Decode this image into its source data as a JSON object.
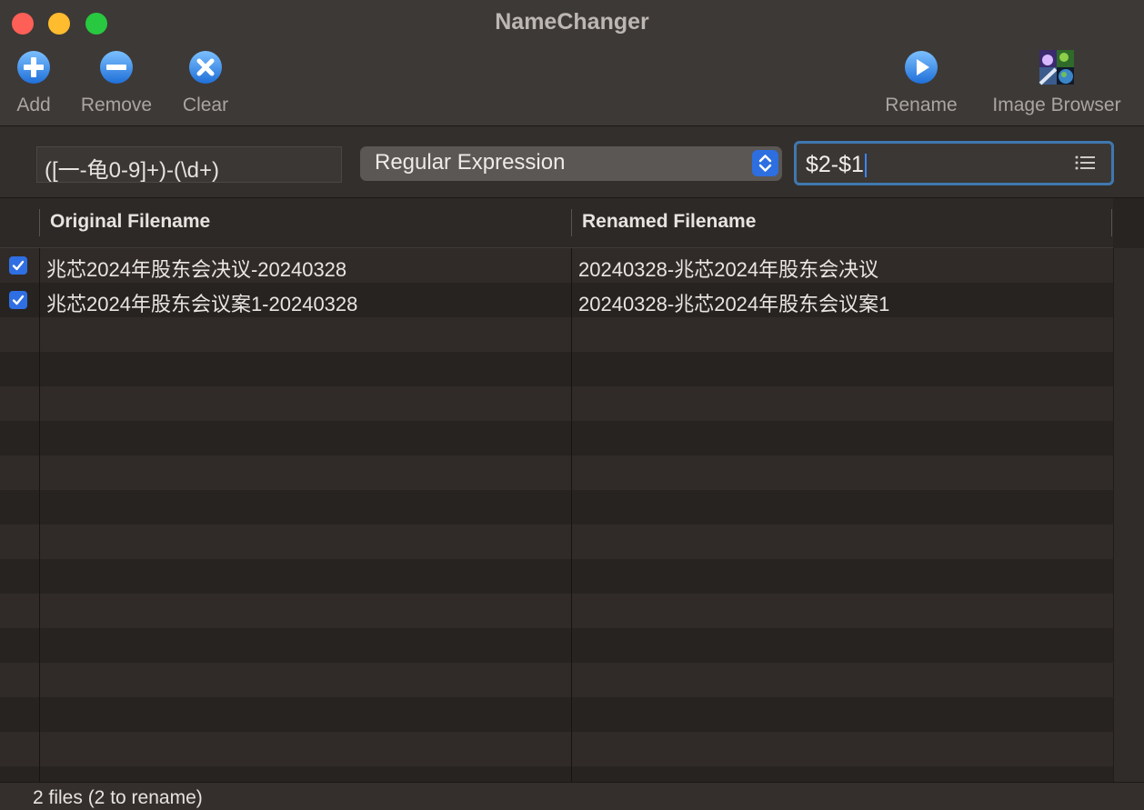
{
  "window": {
    "title": "NameChanger"
  },
  "toolbar": {
    "add_label": "Add",
    "remove_label": "Remove",
    "clear_label": "Clear",
    "rename_label": "Rename",
    "image_browser_label": "Image Browser"
  },
  "controls": {
    "find_value": "([一-龟0-9]+)-(\\d+)",
    "mode_selected": "Regular Expression",
    "replace_value": "$2-$1"
  },
  "table": {
    "columns": [
      "Original Filename",
      "Renamed Filename"
    ],
    "rows": [
      {
        "checked": true,
        "original": "兆芯2024年股东会决议-20240328",
        "renamed": "20240328-兆芯2024年股东会决议"
      },
      {
        "checked": true,
        "original": "兆芯2024年股东会议案1-20240328",
        "renamed": "20240328-兆芯2024年股东会议案1"
      }
    ]
  },
  "status": {
    "text": "2 files (2 to rename)"
  },
  "colors": {
    "accent": "#2f6fe3",
    "close": "#fe5f57",
    "minimize": "#febc2e",
    "maximize": "#28c840",
    "focus_ring": "#3f78b0"
  },
  "icons": [
    "add-icon",
    "remove-icon",
    "clear-icon",
    "rename-icon",
    "image-browser-icon",
    "list-icon",
    "stepper-icon",
    "checkbox-icon"
  ]
}
